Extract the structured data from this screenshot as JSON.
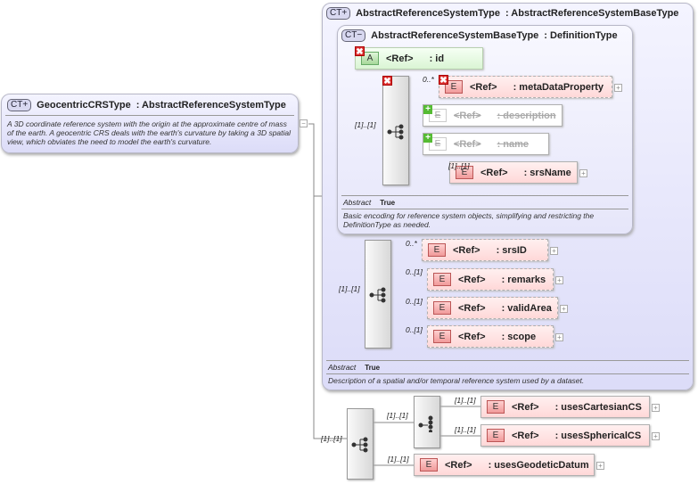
{
  "root": {
    "badge": "CT+",
    "name": "GeocentricCRSType",
    "base": ": AbstractReferenceSystemType",
    "description": "A 3D coordinate reference system with the origin at the approximate centre of mass of the earth. A geocentric CRS deals with the earth's curvature by taking a 3D spatial view, which obviates the need to model the earth's curvature.",
    "collapse": "−"
  },
  "outer": {
    "badge": "CT+",
    "name": "AbstractReferenceSystemType",
    "base": ": AbstractReferenceSystemBaseType",
    "abstract_label": "Abstract",
    "abstract_value": "True",
    "description": "Description of a spatial and/or temporal reference system used by a dataset."
  },
  "inner": {
    "badge": "CT−",
    "name": "AbstractReferenceSystemBaseType",
    "base": ": DefinitionType",
    "abstract_label": "Abstract",
    "abstract_value": "True",
    "description": "Basic encoding for reference system objects, simplifying and restricting the DefinitionType as needed."
  },
  "elements": [
    {
      "kind": "A",
      "ref": "<Ref>",
      "name": ": id",
      "style": "attr",
      "mark": "x"
    },
    {
      "kind": "E",
      "ref": "<Ref>",
      "name": ": metaDataProperty",
      "card": "0..*",
      "style": "opt",
      "mark": "x",
      "expand": "+"
    },
    {
      "kind": "E",
      "ref": "<Ref>",
      "name": ": description",
      "style": "ghost",
      "mark": "+"
    },
    {
      "kind": "E",
      "ref": "<Ref>",
      "name": ": name",
      "style": "ghost",
      "mark": "+"
    },
    {
      "kind": "E",
      "ref": "<Ref>",
      "name": ": srsName",
      "card": "[1]..[1]",
      "style": "",
      "expand": "+"
    },
    {
      "kind": "E",
      "ref": "<Ref>",
      "name": ": srsID",
      "card": "0..*",
      "style": "opt",
      "expand": "+"
    },
    {
      "kind": "E",
      "ref": "<Ref>",
      "name": ": remarks",
      "card": "0..[1]",
      "style": "opt",
      "expand": "+"
    },
    {
      "kind": "E",
      "ref": "<Ref>",
      "name": ": validArea",
      "card": "0..[1]",
      "style": "opt",
      "expand": "+"
    },
    {
      "kind": "E",
      "ref": "<Ref>",
      "name": ": scope",
      "card": "0..[1]",
      "style": "opt",
      "expand": "+"
    },
    {
      "kind": "E",
      "ref": "<Ref>",
      "name": ": usesCartesianCS",
      "card": "[1]..[1]",
      "style": "",
      "expand": "+"
    },
    {
      "kind": "E",
      "ref": "<Ref>",
      "name": ": usesSphericalCS",
      "card": "[1]..[1]",
      "style": "",
      "expand": "+"
    },
    {
      "kind": "E",
      "ref": "<Ref>",
      "name": ": usesGeodeticDatum",
      "card": "[1]..[1]",
      "style": "",
      "expand": "+"
    }
  ],
  "compositors": [
    {
      "type": "sequence",
      "card": "[1]..[1]",
      "mark": "x"
    },
    {
      "type": "sequence",
      "card": "[1]..[1]"
    },
    {
      "type": "sequence",
      "card": "[1]..[1]"
    },
    {
      "type": "choice",
      "card": "[1]..[1]"
    }
  ]
}
